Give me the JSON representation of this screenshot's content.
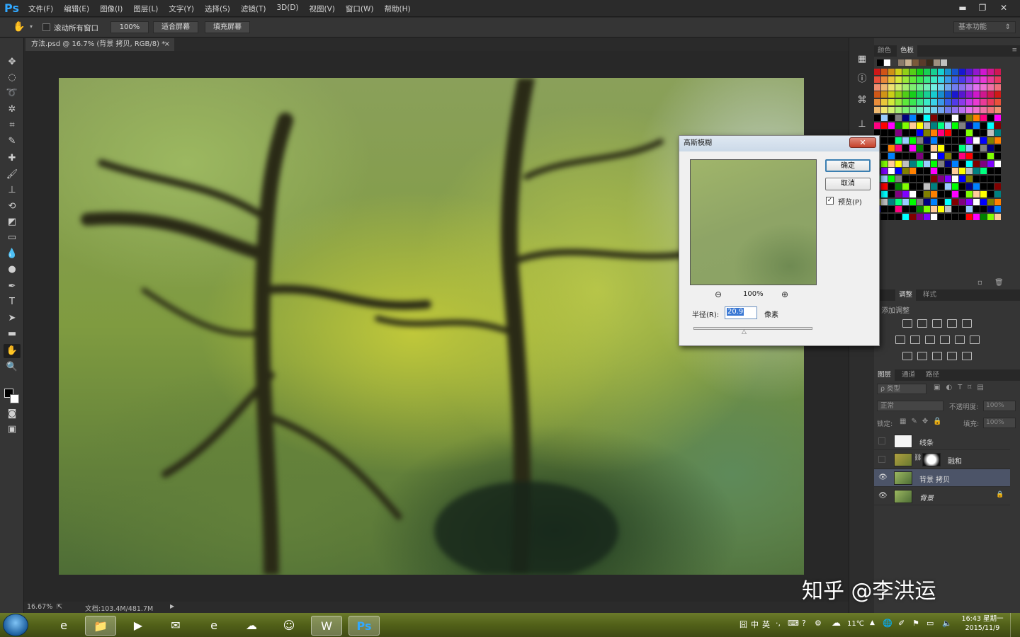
{
  "app": {
    "logo": "Ps"
  },
  "menubar": {
    "items": [
      "文件(F)",
      "编辑(E)",
      "图像(I)",
      "图层(L)",
      "文字(Y)",
      "选择(S)",
      "滤镜(T)",
      "3D(D)",
      "视图(V)",
      "窗口(W)",
      "帮助(H)"
    ]
  },
  "options": {
    "scroll_all_label": "滚动所有窗口",
    "zoom_100": "100%",
    "fit_screen": "适合屏幕",
    "fill_screen": "填充屏幕",
    "workspace": "基本功能"
  },
  "document": {
    "tab_title": "方法.psd @ 16.7% (背景 拷贝, RGB/8) *",
    "close": "×",
    "zoom_status": "16.67%",
    "doc_size": "文档:103.4M/481.7M"
  },
  "panels": {
    "color_tab": "颜色",
    "swatches_tab": "色板",
    "adjust_tab": "调整",
    "styles_tab": "样式",
    "add_adjustment": "添加调整",
    "layers_tab": "图层",
    "channels_tab": "通道",
    "paths_tab": "路径",
    "filter_kind": "ρ 类型",
    "blend_mode": "正常",
    "opacity_label": "不透明度:",
    "opacity_value": "100%",
    "lock_label": "锁定:",
    "fill_label": "填充:",
    "fill_value": "100%"
  },
  "layers": [
    {
      "name": "线条",
      "visible": false
    },
    {
      "name": "融和",
      "visible": false
    },
    {
      "name": "背景 拷贝",
      "visible": true,
      "selected": true
    },
    {
      "name": "背景",
      "visible": true,
      "locked": true
    }
  ],
  "dialog": {
    "title": "高斯模糊",
    "ok": "确定",
    "cancel": "取消",
    "preview_label": "预览(P)",
    "preview_checked": true,
    "zoom": "100%",
    "radius_label": "半径(R):",
    "radius_value": "20.9",
    "unit": "像素"
  },
  "taskbar": {
    "ime": "英",
    "weather": "11℃",
    "time": "16:43 星期一",
    "date": "2015/11/9"
  },
  "watermark": "知乎 @李洪运",
  "colors": {
    "accent": "#31a8ff",
    "selected_layer": "#4c5468",
    "dialog_bg": "#f0f0f0"
  },
  "swatch_colors": [
    "#000000",
    "#ffffff",
    "#ff0000",
    "#ffff00",
    "#00ff00",
    "#00ffff",
    "#0000ff",
    "#ff00ff",
    "#c0c0c0",
    "#808080",
    "#800000",
    "#808000",
    "#008000",
    "#008080",
    "#000080",
    "#800080",
    "#ff8000",
    "#80ff00",
    "#00ff80",
    "#0080ff",
    "#8000ff",
    "#ff0080",
    "#ffcc99",
    "#99ccff"
  ]
}
